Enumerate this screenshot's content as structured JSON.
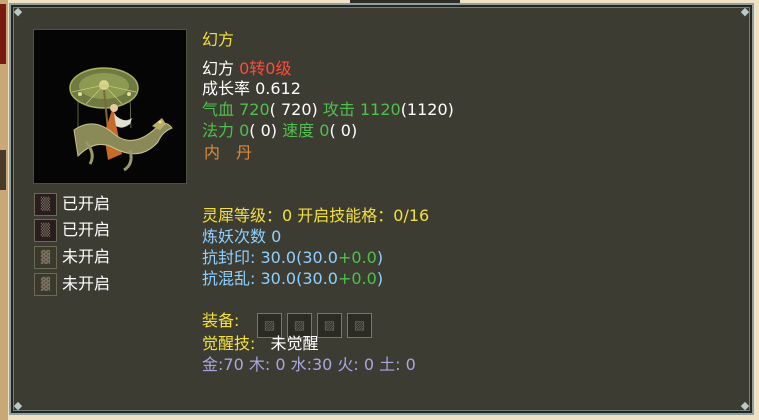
{
  "pet": {
    "name_title": "幻方",
    "name": "幻方",
    "rank": "0转0级",
    "growth_label": "成长率",
    "growth_value": "0.612",
    "hp_label": "气血",
    "hp_value": "720",
    "hp_base": "( 720)",
    "atk_label": "攻击",
    "atk_value": "1120",
    "atk_base": "(1120)",
    "mp_label": "法力",
    "mp_value": "0",
    "mp_base": "( 0)",
    "spd_label": "速度",
    "spd_value": "0",
    "spd_base": "( 0)",
    "inner_dan": "内　丹"
  },
  "skill_slots": [
    {
      "status": "已开启",
      "icon": "opened-slot-icon"
    },
    {
      "status": "已开启",
      "icon": "opened-slot-icon"
    },
    {
      "status": "未开启",
      "icon": "locked-slot-icon"
    },
    {
      "status": "未开启",
      "icon": "locked-slot-icon"
    }
  ],
  "details": {
    "lingxi_label": "灵犀等级：0 开启技能格：0/16",
    "refine_label": "炼妖次数",
    "refine_value": "0",
    "seal_label": "抗封印: ",
    "seal_value": "30.0",
    "seal_base": "(30.0",
    "seal_bonus": "+0.0",
    "seal_close": ")",
    "chaos_label": "抗混乱: ",
    "chaos_value": "30.0",
    "chaos_base": "(30.0",
    "chaos_bonus": "+0.0",
    "chaos_close": ")",
    "equip_label": "装备:",
    "awaken_label": "觉醒技:",
    "awaken_value": "未觉醒",
    "elements": "金:70 木: 0 水:30 火: 0 土: 0"
  },
  "colors": {
    "panel_bg": "#3c3c33",
    "yellow": "#f3e03a",
    "green": "#4fc04c",
    "red": "#ff4b3c",
    "blue": "#8fd0ff",
    "lavender": "#a8a7e0"
  }
}
